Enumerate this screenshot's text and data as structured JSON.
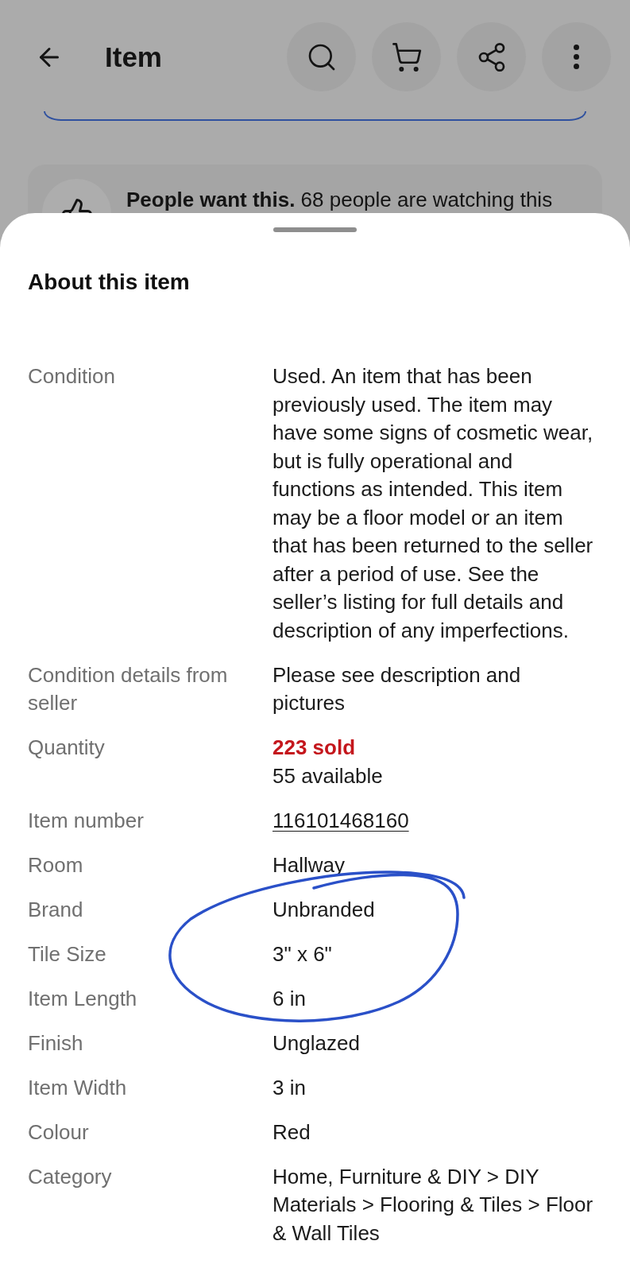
{
  "header": {
    "title": "Item"
  },
  "background_card": {
    "text": "**People want this.** 68 people are watching this"
  },
  "sheet": {
    "title": "About this item",
    "rows": [
      {
        "label": "Condition",
        "values": [
          {
            "kind": "plain",
            "text": "Used. An item that has been previously used. The item may have some signs of cosmetic wear, but is fully operational and functions as intended. This item may be a floor model or an item that has been returned to the seller after a period of use. See the seller’s listing for full details and description of any imperfections."
          }
        ]
      },
      {
        "label": "Condition details from seller",
        "values": [
          {
            "kind": "plain",
            "text": "Please see description and pictures"
          }
        ]
      },
      {
        "label": "Quantity",
        "values": [
          {
            "kind": "sold",
            "text": "223 sold"
          },
          {
            "kind": "plain",
            "text": "55 available"
          }
        ]
      },
      {
        "label": "Item number",
        "values": [
          {
            "kind": "link",
            "text": "116101468160"
          }
        ]
      },
      {
        "label": "Room",
        "values": [
          {
            "kind": "plain",
            "text": "Hallway"
          }
        ]
      },
      {
        "label": "Brand",
        "values": [
          {
            "kind": "plain",
            "text": "Unbranded"
          }
        ]
      },
      {
        "label": "Tile Size",
        "values": [
          {
            "kind": "plain",
            "text": "3\" x 6\""
          }
        ]
      },
      {
        "label": "Item Length",
        "values": [
          {
            "kind": "plain",
            "text": "6 in"
          }
        ]
      },
      {
        "label": "Finish",
        "values": [
          {
            "kind": "plain",
            "text": "Unglazed"
          }
        ]
      },
      {
        "label": "Item Width",
        "values": [
          {
            "kind": "plain",
            "text": "3 in"
          }
        ]
      },
      {
        "label": "Colour",
        "values": [
          {
            "kind": "plain",
            "text": "Red"
          }
        ]
      },
      {
        "label": "Category",
        "values": [
          {
            "kind": "plain",
            "text": "Home, Furniture & DIY > DIY Materials > Flooring & Tiles > Floor & Wall Tiles"
          }
        ]
      }
    ]
  }
}
